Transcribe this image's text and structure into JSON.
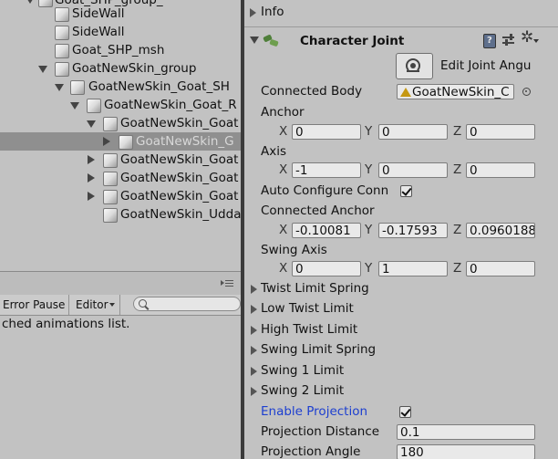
{
  "hierarchy": {
    "rows": [
      {
        "label": "Goat_SHP_group_",
        "arrow": "none",
        "selected": false
      },
      {
        "label": "SideWall",
        "arrow": "none",
        "selected": false
      },
      {
        "label": "SideWall",
        "arrow": "none",
        "selected": false
      },
      {
        "label": "Goat_SHP_msh",
        "arrow": "none",
        "selected": false
      },
      {
        "label": "GoatNewSkin_group",
        "arrow": "down",
        "selected": false
      },
      {
        "label": "GoatNewSkin_Goat_SH",
        "arrow": "down",
        "selected": false
      },
      {
        "label": "GoatNewSkin_Goat_R",
        "arrow": "down",
        "selected": false
      },
      {
        "label": "GoatNewSkin_Goat",
        "arrow": "down",
        "selected": false
      },
      {
        "label": "GoatNewSkin_G",
        "arrow": "right",
        "selected": true
      },
      {
        "label": "GoatNewSkin_Goat",
        "arrow": "right",
        "selected": false
      },
      {
        "label": "GoatNewSkin_Goat",
        "arrow": "right",
        "selected": false
      },
      {
        "label": "GoatNewSkin_Goat",
        "arrow": "right",
        "selected": false
      },
      {
        "label": "GoatNewSkin_Udda",
        "arrow": "none",
        "selected": false
      }
    ]
  },
  "console": {
    "error_pause": "Error Pause",
    "editor": "Editor",
    "search_placeholder": "",
    "message": "ched animations list."
  },
  "inspector": {
    "info_label": "Info",
    "component_title": "Character Joint",
    "edit_button": "Edit Joint Angu",
    "connected_body_label": "Connected Body",
    "connected_body_value": "GoatNewSkin_C",
    "anchor_label": "Anchor",
    "anchor": {
      "x": "0",
      "y": "0",
      "z": "0"
    },
    "axis_label": "Axis",
    "axis": {
      "x": "-1",
      "y": "0",
      "z": "0"
    },
    "auto_configure_label": "Auto Configure Conn",
    "connected_anchor_label": "Connected Anchor",
    "connected_anchor": {
      "x": "-0.10081",
      "y": "-0.17593",
      "z": "0.0960188"
    },
    "swing_axis_label": "Swing Axis",
    "swing_axis": {
      "x": "0",
      "y": "1",
      "z": "0"
    },
    "x_label": "X",
    "y_label": "Y",
    "z_label": "Z",
    "foldouts": [
      "Twist Limit Spring",
      "Low Twist Limit",
      "High Twist Limit",
      "Swing Limit Spring",
      "Swing 1 Limit",
      "Swing 2 Limit"
    ],
    "enable_projection_label": "Enable Projection",
    "projection_distance_label": "Projection Distance",
    "projection_distance_value": "0.1",
    "projection_angle_label": "Projection Angle",
    "projection_angle_value": "180"
  },
  "colors": {
    "accent_blue": "#1d3fd0",
    "selection_row": "#8f8f8f"
  }
}
